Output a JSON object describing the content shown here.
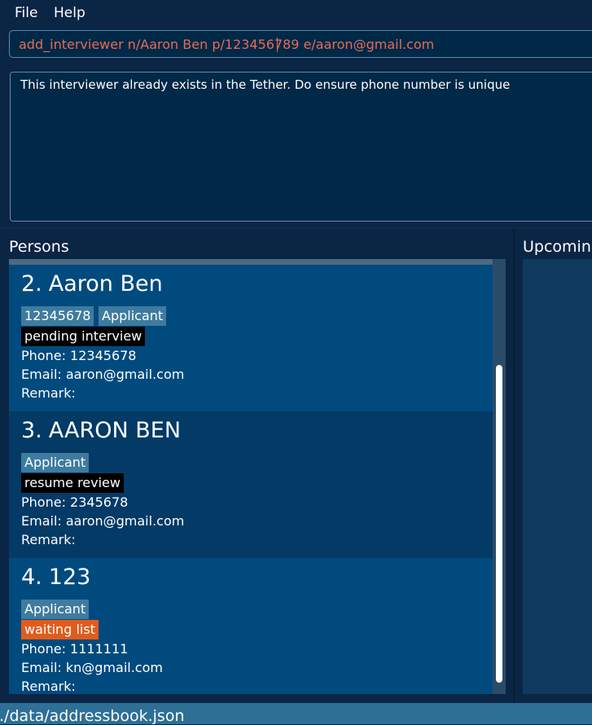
{
  "menu": {
    "file": "File",
    "help": "Help"
  },
  "command": {
    "value": "add_interviewer n/Aaron Ben p/123456789 e/aaron@gmail.com"
  },
  "result": {
    "text": "This interviewer already exists in the Tether. Do ensure phone number is unique"
  },
  "persons": {
    "title": "Persons",
    "cards": [
      {
        "index": "2.",
        "name": "Aaron Ben",
        "tags": [
          "12345678",
          "Applicant"
        ],
        "status": "pending interview",
        "status_color": "#000000",
        "phone": "Phone: 12345678",
        "email": "Email: aaron@gmail.com",
        "remark": "Remark:"
      },
      {
        "index": "3.",
        "name": "AARON BEN",
        "tags": [
          "Applicant"
        ],
        "status": "resume review",
        "status_color": "#000000",
        "phone": "Phone: 2345678",
        "email": "Email: aaron@gmail.com",
        "remark": "Remark:"
      },
      {
        "index": "4.",
        "name": "123",
        "tags": [
          "Applicant"
        ],
        "status": "waiting list",
        "status_color": "#e05c1d",
        "phone": "Phone: 1111111",
        "email": "Email: kn@gmail.com",
        "remark": "Remark:"
      }
    ]
  },
  "upcoming": {
    "title": "Upcomin"
  },
  "status_bar": {
    "path": "./data/addressbook.json"
  },
  "colors": {
    "background": "#0b2545",
    "command_text": "#e26c55",
    "card_odd": "#014a7d",
    "card_even": "#033a66",
    "tag_blue": "#3e7b9f",
    "status_bar": "#2e6f96"
  }
}
